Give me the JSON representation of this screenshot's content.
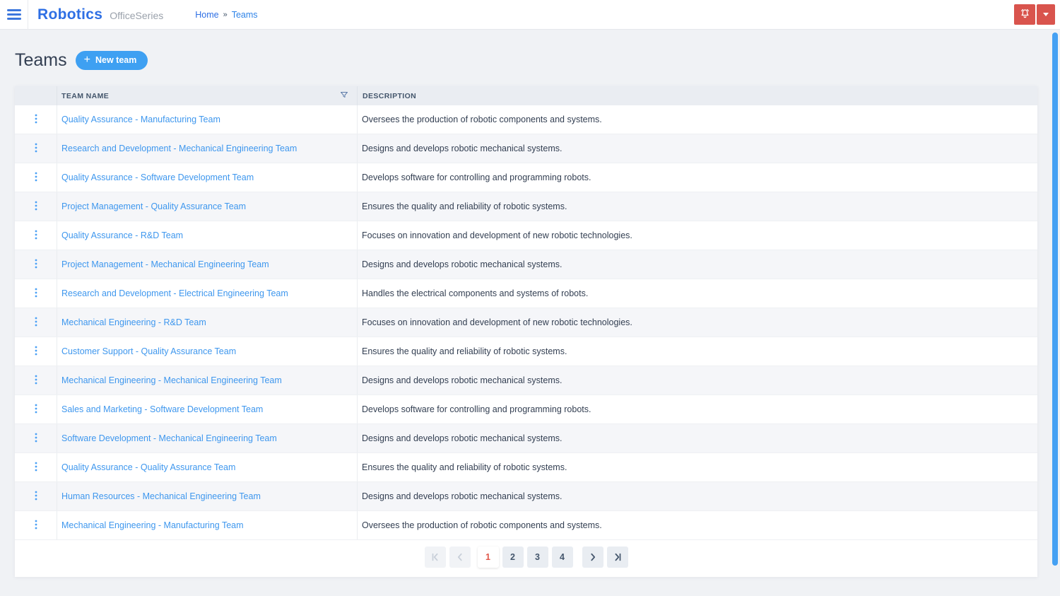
{
  "header": {
    "logo_title": "Robotics",
    "logo_subtitle": "OfficeSeries",
    "breadcrumb": {
      "home": "Home",
      "separator": "»",
      "current": "Teams"
    }
  },
  "page": {
    "title": "Teams",
    "new_team_label": "New team",
    "new_team_plus": "+"
  },
  "table": {
    "columns": {
      "team_name": "TEAM NAME",
      "description": "DESCRIPTION"
    },
    "rows": [
      {
        "name": "Quality Assurance - Manufacturing Team",
        "description": "Oversees the production of robotic components and systems."
      },
      {
        "name": "Research and Development - Mechanical Engineering Team",
        "description": "Designs and develops robotic mechanical systems."
      },
      {
        "name": "Quality Assurance - Software Development Team",
        "description": "Develops software for controlling and programming robots."
      },
      {
        "name": "Project Management - Quality Assurance Team",
        "description": "Ensures the quality and reliability of robotic systems."
      },
      {
        "name": "Quality Assurance - R&D Team",
        "description": "Focuses on innovation and development of new robotic technologies."
      },
      {
        "name": "Project Management - Mechanical Engineering Team",
        "description": "Designs and develops robotic mechanical systems."
      },
      {
        "name": "Research and Development - Electrical Engineering Team",
        "description": "Handles the electrical components and systems of robots."
      },
      {
        "name": "Mechanical Engineering - R&D Team",
        "description": "Focuses on innovation and development of new robotic technologies."
      },
      {
        "name": "Customer Support - Quality Assurance Team",
        "description": "Ensures the quality and reliability of robotic systems."
      },
      {
        "name": "Mechanical Engineering - Mechanical Engineering Team",
        "description": "Designs and develops robotic mechanical systems."
      },
      {
        "name": "Sales and Marketing - Software Development Team",
        "description": "Develops software for controlling and programming robots."
      },
      {
        "name": "Software Development - Mechanical Engineering Team",
        "description": "Designs and develops robotic mechanical systems."
      },
      {
        "name": "Quality Assurance - Quality Assurance Team",
        "description": "Ensures the quality and reliability of robotic systems."
      },
      {
        "name": "Human Resources - Mechanical Engineering Team",
        "description": "Designs and develops robotic mechanical systems."
      },
      {
        "name": "Mechanical Engineering - Manufacturing Team",
        "description": "Oversees the production of robotic components and systems."
      }
    ]
  },
  "pagination": {
    "pages": [
      "1",
      "2",
      "3",
      "4"
    ],
    "active": "1"
  },
  "icons": {
    "menu": "hamburger",
    "notifications": "bell",
    "account": "caret-down",
    "filter": "funnel",
    "row_actions": "kebab-vertical",
    "pagination_first": "first-page",
    "pagination_prev": "previous-page",
    "pagination_next": "next-page",
    "pagination_last": "last-page"
  },
  "colors": {
    "brand_blue": "#2e6fe4",
    "link_blue": "#3e97ee",
    "button_blue": "#3ea0f2",
    "alert_red": "#d9544d",
    "active_page_red": "#e0574a",
    "scrollbar_blue": "#45a1f3",
    "header_text": "#44566c",
    "body_text": "#333f52"
  }
}
